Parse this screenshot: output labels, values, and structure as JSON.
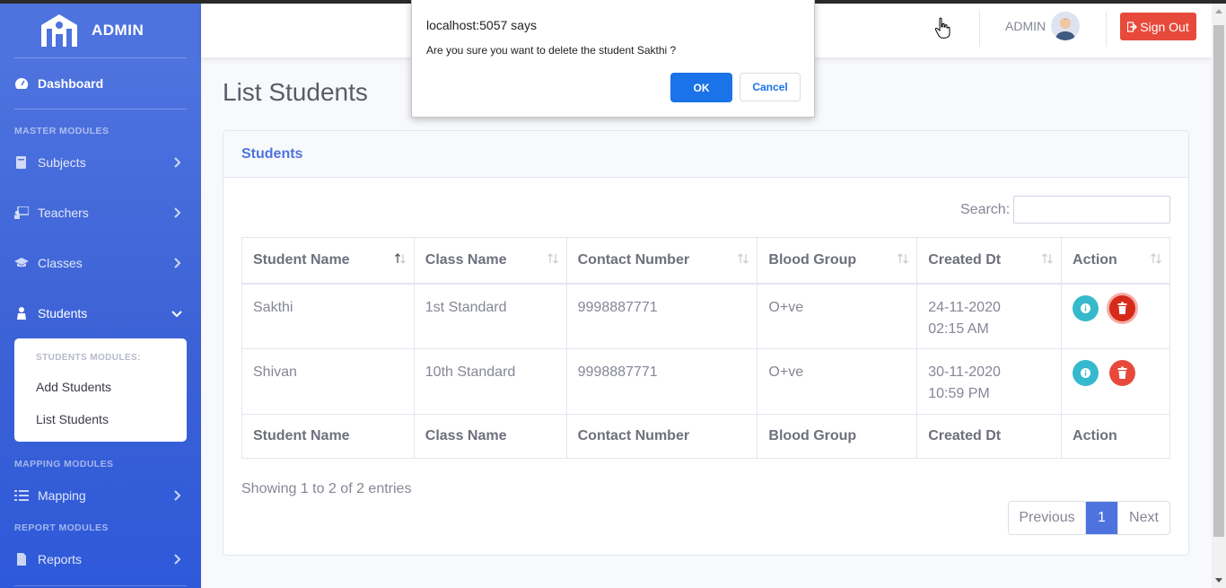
{
  "sidebar": {
    "brand": "ADMIN",
    "dashboard": "Dashboard",
    "master_heading": "MASTER MODULES",
    "items": {
      "subjects": "Subjects",
      "teachers": "Teachers",
      "classes": "Classes",
      "students": "Students",
      "mapping": "Mapping",
      "reports": "Reports"
    },
    "students_sub": {
      "heading": "STUDENTS MODULES:",
      "add": "Add Students",
      "list": "List Students"
    },
    "mapping_heading": "MAPPING MODULES",
    "report_heading": "REPORT MODULES"
  },
  "topbar": {
    "admin_name": "ADMIN",
    "signout": "Sign Out"
  },
  "page": {
    "title": "List Students"
  },
  "card": {
    "title": "Students",
    "search_label": "Search:",
    "search_value": "",
    "columns": [
      "Student Name",
      "Class Name",
      "Contact Number",
      "Blood Group",
      "Created Dt",
      "Action"
    ],
    "rows": [
      {
        "name": "Sakthi",
        "class": "1st Standard",
        "contact": "9998887771",
        "blood": "O+ve",
        "date": "24-11-2020",
        "time": "02:15 AM"
      },
      {
        "name": "Shivan",
        "class": "10th Standard",
        "contact": "9998887771",
        "blood": "O+ve",
        "date": "30-11-2020",
        "time": "10:59 PM"
      }
    ],
    "info": "Showing 1 to 2 of 2 entries",
    "pager": {
      "prev": "Previous",
      "current": "1",
      "next": "Next"
    }
  },
  "dialog": {
    "title": "localhost:5057 says",
    "message": "Are you sure you want to delete the student Sakthi ?",
    "ok": "OK",
    "cancel": "Cancel"
  },
  "colors": {
    "primary": "#4e73df",
    "danger": "#e74a3b",
    "info": "#36b9cc",
    "dialog_button": "#1a73e8"
  }
}
